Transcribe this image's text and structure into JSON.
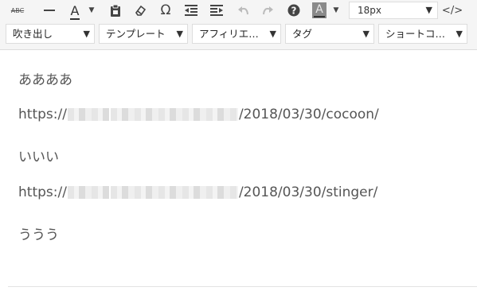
{
  "toolbar": {
    "row1": {
      "strikethrough_label": "ABC",
      "fontsize": {
        "value": "18px",
        "caret": "▼"
      },
      "text_color_letter": "A",
      "bg_color_letter": "A",
      "dropdown_caret": "▼",
      "code_label": "</>"
    },
    "row2": {
      "items": [
        {
          "label": "吹き出し"
        },
        {
          "label": "テンプレート"
        },
        {
          "label": "アフィリエ…"
        },
        {
          "label": "タグ"
        },
        {
          "label": "ショートコ…"
        }
      ],
      "caret": "▼"
    }
  },
  "content": {
    "lines": [
      {
        "text": "ああああ"
      },
      {
        "prefix": "https://",
        "suffix": "/2018/03/30/cocoon/"
      },
      {
        "text": "いいい"
      },
      {
        "prefix": "https://",
        "suffix": "/2018/03/30/stinger/"
      },
      {
        "text": "ううう"
      }
    ]
  }
}
